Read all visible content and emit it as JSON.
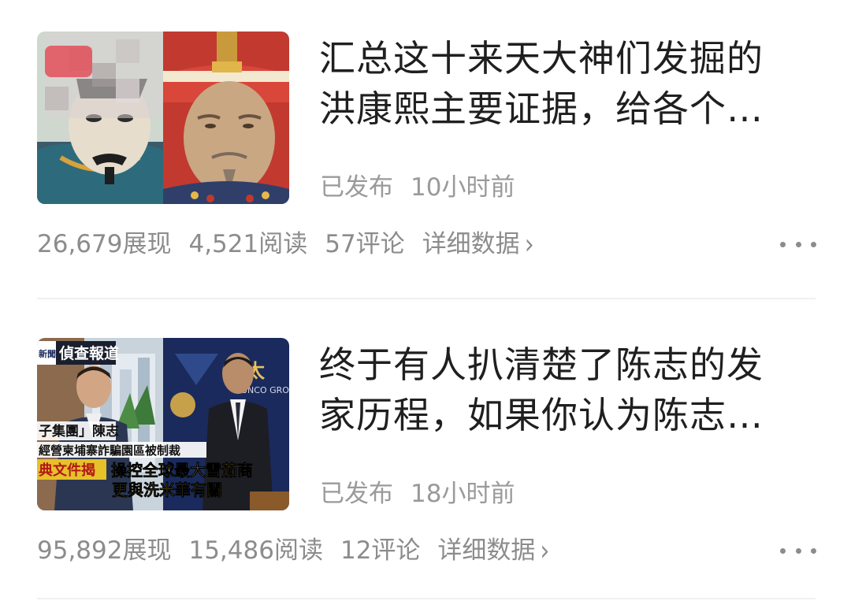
{
  "articles": [
    {
      "title": "汇总这十来天大神们发掘的洪康熙主要证据，给各个…",
      "status": "已发布",
      "time": "10小时前",
      "impressions": "26,679展现",
      "reads": "4,521阅读",
      "comments": "57评论",
      "detail": "详细数据",
      "thumbnail": "two-qing-emperor-portraits"
    },
    {
      "title": "终于有人扒清楚了陈志的发家历程，如果你认为陈志…",
      "status": "已发布",
      "time": "18小时前",
      "impressions": "95,892展现",
      "reads": "15,486阅读",
      "comments": "12评论",
      "detail": "详细数据",
      "thumbnail": "news-video-screenshot",
      "thumb_text": {
        "tag": "新聞",
        "program": "偵查報道",
        "logo": "太",
        "logo_sub": "SUNCO GROUP",
        "line1": "子集團」陳志",
        "line2": "經營柬埔寨詐騙園區被制裁",
        "badge": "典文件揭",
        "headline1": "操控全球最大雪茄商",
        "headline2": "更與洗米華有關"
      }
    }
  ],
  "icons": {
    "more": "more-horizontal-icon",
    "chevron": "chevron-right-icon"
  }
}
